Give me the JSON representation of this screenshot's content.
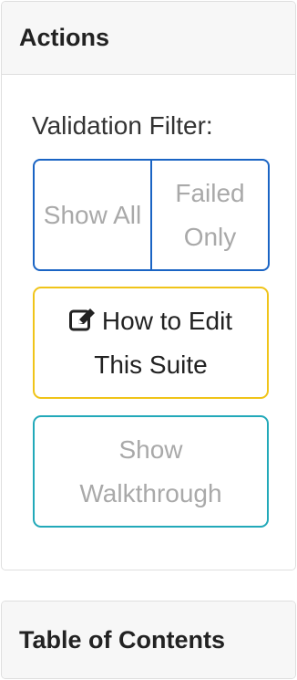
{
  "actions_panel": {
    "title": "Actions",
    "validation_filter_label": "Validation Filter:",
    "show_all_label": "Show All",
    "failed_only_label": "Failed Only",
    "edit_button_icon": "edit-icon",
    "edit_button_label": "How to Edit This Suite",
    "walkthrough_button_label": "Show Walkthrough"
  },
  "toc_panel": {
    "title": "Table of Contents"
  },
  "colors": {
    "primary_outline": "#1a64c4",
    "warning_outline": "#f0c419",
    "info_outline": "#22a9b9",
    "muted_text": "#a9a9a9"
  }
}
